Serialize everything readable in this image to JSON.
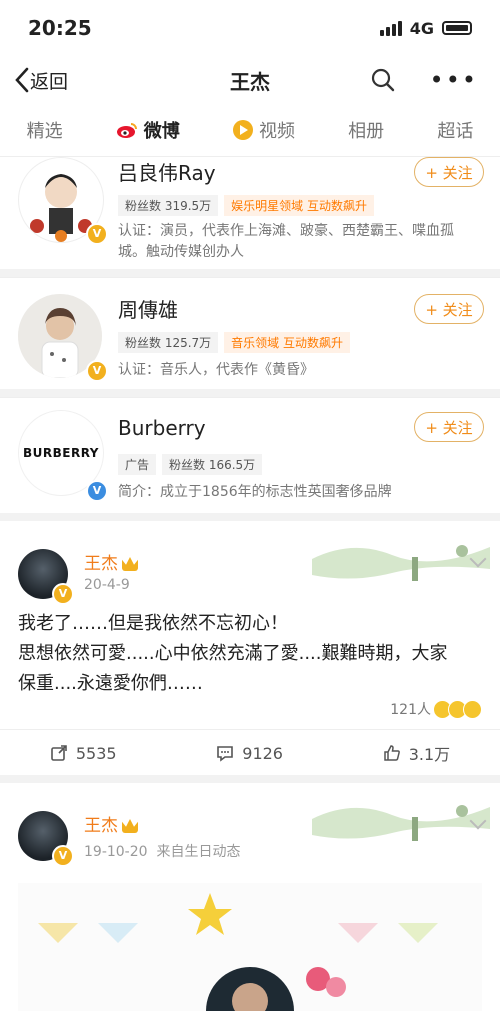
{
  "status": {
    "time": "20:25",
    "network": "4G"
  },
  "nav": {
    "back_label": "返回",
    "title": "王杰"
  },
  "tabs": [
    {
      "label": "精选"
    },
    {
      "label": "微博"
    },
    {
      "label": "视频"
    },
    {
      "label": "相册"
    },
    {
      "label": "超话"
    }
  ],
  "users": [
    {
      "name": "吕良伟Ray",
      "fans": "粉丝数 319.5万",
      "tag": "娱乐明星领域 互动数飙升",
      "desc": "认证：演员，代表作上海滩、跛豪、西楚霸王、喋血孤城。触动传媒创办人",
      "follow": "+ 关注"
    },
    {
      "name": "周傳雄",
      "fans": "粉丝数 125.7万",
      "tag": "音乐领域 互动数飙升",
      "desc": "认证：音乐人，代表作《黄昏》",
      "follow": "+ 关注"
    },
    {
      "name": "Burberry",
      "ad": "广告",
      "fans": "粉丝数 166.5万",
      "desc": "简介：成立于1856年的标志性英国奢侈品牌",
      "logo_text": "BURBERRY",
      "follow": "+ 关注"
    }
  ],
  "posts": [
    {
      "author": "王杰",
      "time": "20-4-9",
      "text_lines": [
        "我老了……但是我依然不忘初心！",
        "思想依然可愛.....心中依然充滿了愛....艱難時期，大家",
        "保重....永遠愛你們……"
      ],
      "likes_count": "121人",
      "reposts": "5535",
      "comments": "9126",
      "likes": "3.1万"
    },
    {
      "author": "王杰",
      "time": "19-10-20",
      "source": "来自生日动态"
    }
  ],
  "colors": {
    "accent": "#f07c1a",
    "verify_gold": "#f2b01e",
    "verify_blue": "#3b8de0"
  }
}
